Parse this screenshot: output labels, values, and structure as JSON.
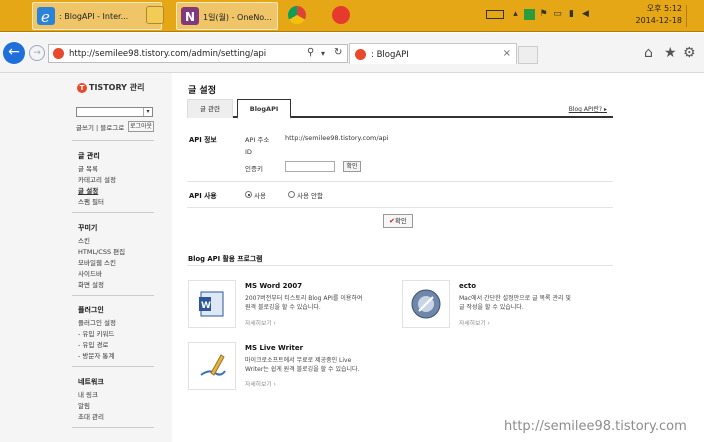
{
  "taskbar": {
    "buttons": [
      {
        "label": ": BlogAPI - Inter...",
        "icon": "internet-explorer-icon"
      },
      {
        "label": "",
        "icon": "file-explorer-icon"
      },
      {
        "label": "1일(월) - OneNo...",
        "icon": "onenote-icon"
      },
      {
        "label": "",
        "icon": "chrome-icon"
      },
      {
        "label": "",
        "icon": "camera-app-icon"
      }
    ],
    "clock": {
      "time": "오후 5:12",
      "date": "2014-12-18"
    }
  },
  "browser": {
    "url": "http://semilee98.tistory.com/admin/setting/api",
    "tab_title": ": BlogAPI"
  },
  "sidebar": {
    "logo": "TISTORY 관리",
    "links": "글쓰기 | 블로그로",
    "logout": "로그아웃",
    "sections": [
      {
        "title": "글 관리",
        "items": [
          "글 목록",
          "카테고리 설정",
          "글 설정",
          "스팸 필터"
        ]
      },
      {
        "title": "꾸미기",
        "items": [
          "스킨",
          "HTML/CSS 편집",
          "모바일웹 스킨",
          "사이드바",
          "화면 설정"
        ]
      },
      {
        "title": "플러그인",
        "items": [
          "플러그인 설정",
          "- 유입 키워드",
          "- 유입 경로",
          "- 방문자 통계"
        ]
      },
      {
        "title": "네트워크",
        "items": [
          "내 링크",
          "알림",
          "초대 관리"
        ]
      }
    ]
  },
  "main": {
    "page_title": "글 설정",
    "tabs": [
      "글 관련",
      "BlogAPI"
    ],
    "help_link": "Blog API란? ▸",
    "api_info": {
      "label": "API 정보",
      "api_addr_label": "API 주소",
      "api_addr_value": "http://semilee98.tistory.com/api",
      "id_label": "ID",
      "key_label": "인증키",
      "key_button": "확인"
    },
    "api_use": {
      "label": "API 사용",
      "options": [
        "사용",
        "사용 안함"
      ],
      "selected": 0
    },
    "confirm_button": "확인",
    "programs_title": "Blog API 활용 프로그램",
    "programs": [
      {
        "name": "MS Word 2007",
        "desc1": "2007버전부터 티스토리 Blog API를 이용하여",
        "desc2": "원격 블로깅을 할 수 있습니다.",
        "more": "자세히보기 ›"
      },
      {
        "name": "ecto",
        "desc1": "Mac에서 간단한 설정만으로 글 목록 관리 및",
        "desc2": "글 작성을 할 수 있습니다.",
        "more": "자세히보기 ›"
      },
      {
        "name": "MS Live Writer",
        "desc1": "마이크로소프트에서 무료로 제공중인 Live",
        "desc2": "Writer는 쉽게 원격 블로깅을 할 수 있습니다.",
        "more": "자세히보기 ›"
      }
    ]
  },
  "watermark": "http://semilee98.tistory.com"
}
